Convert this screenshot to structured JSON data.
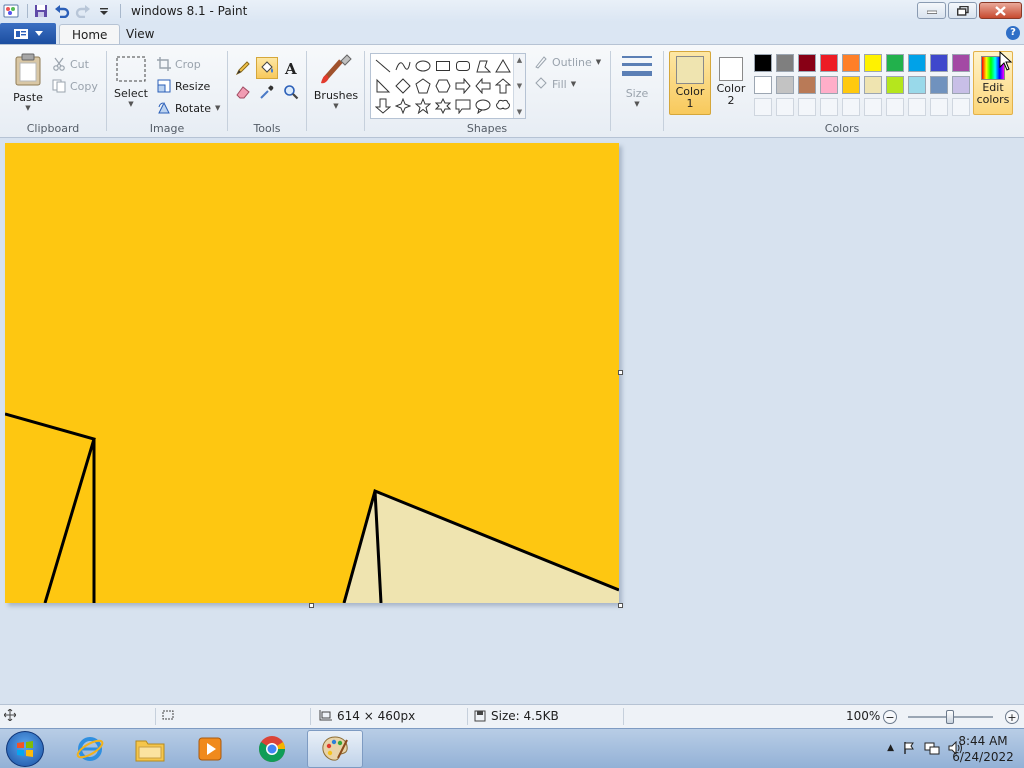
{
  "window": {
    "title": "windows 8.1 - Paint"
  },
  "tabs": {
    "file_label": "",
    "home": "Home",
    "view": "View"
  },
  "clipboard": {
    "paste": "Paste",
    "cut": "Cut",
    "copy": "Copy",
    "group_label": "Clipboard"
  },
  "image": {
    "select": "Select",
    "crop": "Crop",
    "resize": "Resize",
    "rotate": "Rotate",
    "group_label": "Image"
  },
  "tools": {
    "group_label": "Tools",
    "items": [
      "pencil",
      "fill",
      "text",
      "eraser",
      "color-picker",
      "magnifier"
    ],
    "active": "fill"
  },
  "brushes": {
    "label": "Brushes"
  },
  "shapes": {
    "group_label": "Shapes",
    "outline": "Outline",
    "fill": "Fill"
  },
  "size": {
    "label": "Size"
  },
  "colors": {
    "group_label": "Colors",
    "color1_label_line1": "Color",
    "color1_label_line2": "1",
    "color2_label_line1": "Color",
    "color2_label_line2": "2",
    "color1": "#efe4b0",
    "color2": "#ffffff",
    "edit_line1": "Edit",
    "edit_line2": "colors",
    "palette": [
      "#000000",
      "#7f7f7f",
      "#880015",
      "#ed1c24",
      "#ff7f27",
      "#fff200",
      "#22b14c",
      "#00a2e8",
      "#3f48cc",
      "#a349a4",
      "#ffffff",
      "#c3c3c3",
      "#b97a57",
      "#ffaec9",
      "#ffc90e",
      "#efe4b0",
      "#b5e61d",
      "#99d9ea",
      "#7092be",
      "#c8bfe7",
      "",
      "",
      "",
      "",
      "",
      "",
      "",
      "",
      "",
      ""
    ]
  },
  "canvas": {
    "background": "#fec711",
    "fill_color": "#efe4b0"
  },
  "status": {
    "dimensions": "614 × 460px",
    "size": "Size: 4.5KB",
    "zoom": "100%"
  },
  "taskbar": {
    "time": "8:44 AM",
    "date": "6/24/2022"
  }
}
